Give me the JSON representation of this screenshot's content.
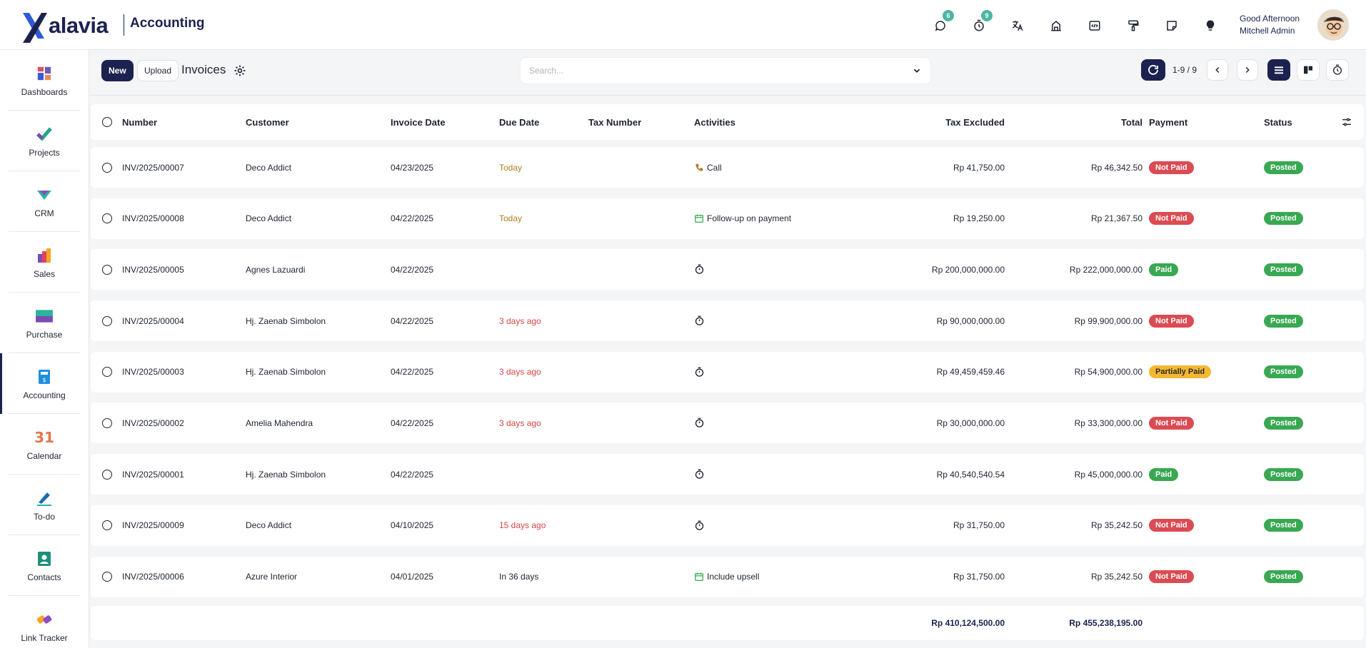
{
  "app": {
    "brand": "alavia",
    "module": "Accounting"
  },
  "header": {
    "greeting": "Good Afternoon",
    "user": "Mitchell Admin",
    "messages_badge": "6",
    "activities_badge": "9"
  },
  "sidebar": {
    "items": [
      {
        "label": "Dashboards"
      },
      {
        "label": "Projects"
      },
      {
        "label": "CRM"
      },
      {
        "label": "Sales"
      },
      {
        "label": "Purchase"
      },
      {
        "label": "Accounting"
      },
      {
        "label": "Calendar",
        "icon_text": "31"
      },
      {
        "label": "To-do"
      },
      {
        "label": "Contacts"
      },
      {
        "label": "Link Tracker"
      }
    ]
  },
  "control": {
    "new_label": "New",
    "upload_label": "Upload",
    "title": "Invoices",
    "search_placeholder": "Search...",
    "pager": "1-9 / 9"
  },
  "table": {
    "columns": {
      "number": "Number",
      "customer": "Customer",
      "invoice_date": "Invoice Date",
      "due_date": "Due Date",
      "tax_number": "Tax Number",
      "activities": "Activities",
      "tax_excluded": "Tax Excluded",
      "total": "Total",
      "payment": "Payment",
      "status": "Status"
    },
    "rows": [
      {
        "number": "INV/2025/00007",
        "customer": "Deco Addict",
        "invoice_date": "04/23/2025",
        "due": "Today",
        "activity": "Call",
        "tax_excluded": "Rp 41,750.00",
        "total": "Rp 46,342.50",
        "payment": "Not Paid",
        "status": "Posted"
      },
      {
        "number": "INV/2025/00008",
        "customer": "Deco Addict",
        "invoice_date": "04/22/2025",
        "due": "Today",
        "activity": "Follow-up on payment",
        "tax_excluded": "Rp 19,250.00",
        "total": "Rp 21,367.50",
        "payment": "Not Paid",
        "status": "Posted"
      },
      {
        "number": "INV/2025/00005",
        "customer": "Agnes Lazuardi",
        "invoice_date": "04/22/2025",
        "due": "",
        "activity": "",
        "tax_excluded": "Rp 200,000,000.00",
        "total": "Rp 222,000,000.00",
        "payment": "Paid",
        "status": "Posted"
      },
      {
        "number": "INV/2025/00004",
        "customer": "Hj. Zaenab Simbolon",
        "invoice_date": "04/22/2025",
        "due": "3 days ago",
        "activity": "",
        "tax_excluded": "Rp 90,000,000.00",
        "total": "Rp 99,900,000.00",
        "payment": "Not Paid",
        "status": "Posted"
      },
      {
        "number": "INV/2025/00003",
        "customer": "Hj. Zaenab Simbolon",
        "invoice_date": "04/22/2025",
        "due": "3 days ago",
        "activity": "",
        "tax_excluded": "Rp 49,459,459.46",
        "total": "Rp 54,900,000.00",
        "payment": "Partially Paid",
        "status": "Posted"
      },
      {
        "number": "INV/2025/00002",
        "customer": "Amelia Mahendra",
        "invoice_date": "04/22/2025",
        "due": "3 days ago",
        "activity": "",
        "tax_excluded": "Rp 30,000,000.00",
        "total": "Rp 33,300,000.00",
        "payment": "Not Paid",
        "status": "Posted"
      },
      {
        "number": "INV/2025/00001",
        "customer": "Hj. Zaenab Simbolon",
        "invoice_date": "04/22/2025",
        "due": "",
        "activity": "",
        "tax_excluded": "Rp 40,540,540.54",
        "total": "Rp 45,000,000.00",
        "payment": "Paid",
        "status": "Posted"
      },
      {
        "number": "INV/2025/00009",
        "customer": "Deco Addict",
        "invoice_date": "04/10/2025",
        "due": "15 days ago",
        "activity": "",
        "tax_excluded": "Rp 31,750.00",
        "total": "Rp 35,242.50",
        "payment": "Not Paid",
        "status": "Posted"
      },
      {
        "number": "INV/2025/00006",
        "customer": "Azure Interior",
        "invoice_date": "04/01/2025",
        "due": "In 36 days",
        "activity": "Include upsell",
        "tax_excluded": "Rp 31,750.00",
        "total": "Rp 35,242.50",
        "payment": "Not Paid",
        "status": "Posted"
      }
    ],
    "totals": {
      "tax_excluded": "Rp 410,124,500.00",
      "total": "Rp 455,238,195.00"
    }
  },
  "colors": {
    "navy": "#1b2250",
    "paid": "#39a852",
    "not_paid": "#dc4b52",
    "partial": "#f5b731",
    "overdue": "#d64545",
    "today": "#b07d23"
  }
}
